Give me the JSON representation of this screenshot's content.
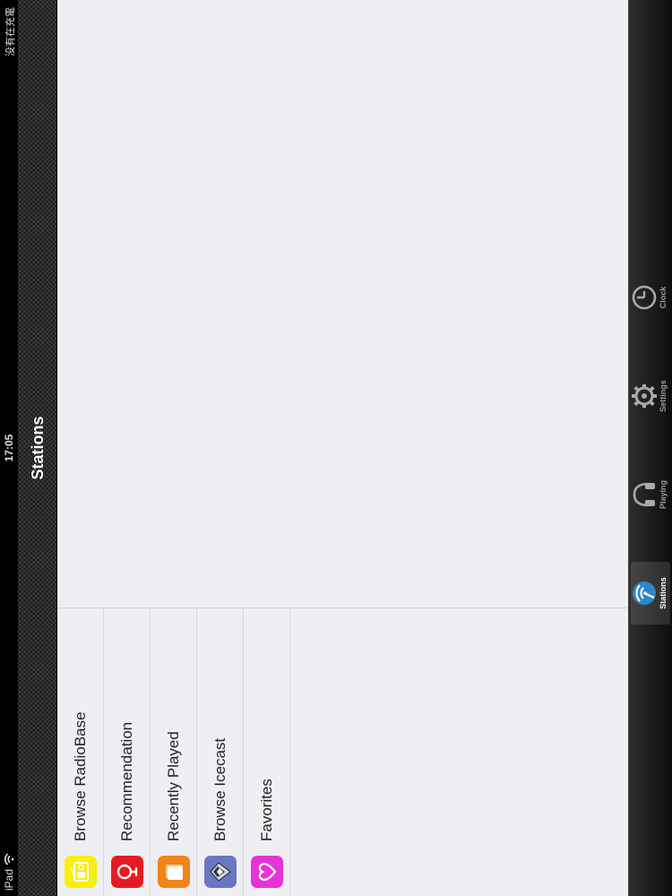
{
  "status_bar": {
    "device": "iPad",
    "time": "17:05",
    "charging_status": "没有在充電"
  },
  "nav_bar": {
    "title": "Stations"
  },
  "stations_menu": [
    {
      "label": "Browse RadioBase",
      "icon": "radiobase-icon",
      "color": "#f7ee12"
    },
    {
      "label": "Recommendation",
      "icon": "recommendation-icon",
      "color": "#e61b22"
    },
    {
      "label": "Recently Played",
      "icon": "recently-played-icon",
      "color": "#f08418"
    },
    {
      "label": "Browse Icecast",
      "icon": "icecast-icon",
      "color": "#6877bf"
    },
    {
      "label": "Favorites",
      "icon": "favorites-icon",
      "color": "#e534d6"
    }
  ],
  "tab_bar": {
    "selected": "Stations",
    "tabs": [
      {
        "label": "Stations",
        "icon": "stations-icon"
      },
      {
        "label": "Playing",
        "icon": "playing-icon"
      },
      {
        "label": "Settings",
        "icon": "settings-icon"
      },
      {
        "label": "Clock",
        "icon": "clock-icon"
      }
    ]
  }
}
